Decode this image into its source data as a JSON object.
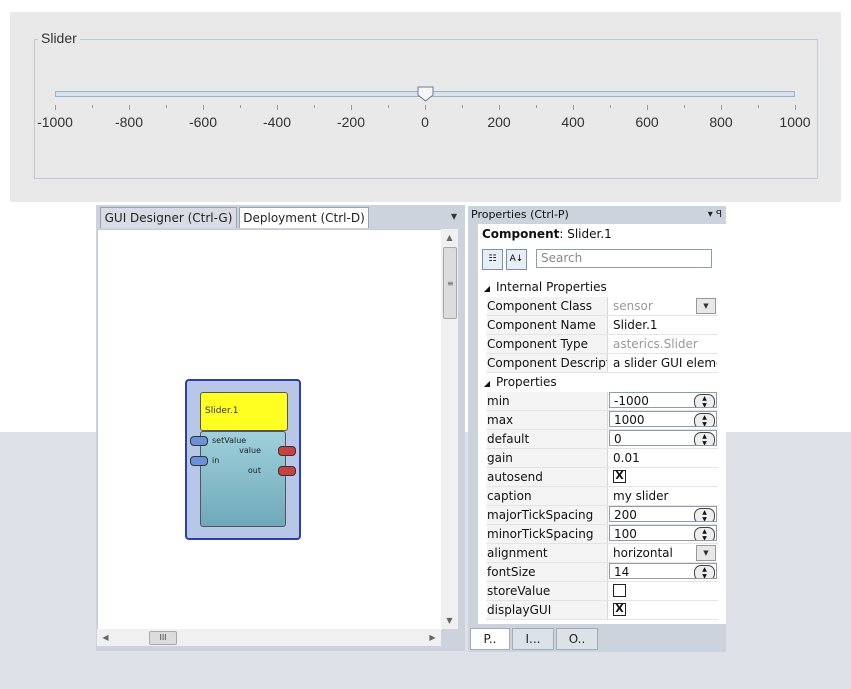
{
  "slider_preview": {
    "caption": "Slider",
    "min": -1000,
    "max": 1000,
    "value": 0,
    "tick_labels": [
      "-1000",
      "-800",
      "-600",
      "-400",
      "-200",
      "0",
      "200",
      "400",
      "600",
      "800",
      "1000"
    ]
  },
  "designer": {
    "tabs": [
      {
        "label": "GUI Designer (Ctrl-G)"
      },
      {
        "label": "Deployment (Ctrl-D)"
      }
    ],
    "menu_glyph": "▾",
    "component": {
      "title": "Slider.1",
      "input_ports": [
        "setValue",
        "in"
      ],
      "output_ports": [
        "value",
        "out"
      ]
    },
    "hscroll_grip": "III"
  },
  "properties": {
    "title": "Properties (Ctrl-P)",
    "pin_glyph": "▾ ꟼ",
    "component_label": "Component",
    "component_name": ": Slider.1",
    "search_placeholder": "Search",
    "categories": {
      "internal": "Internal Properties",
      "properties": "Properties"
    },
    "internal_rows": [
      {
        "name": "Component Class",
        "value": "sensor"
      },
      {
        "name": "Component Name",
        "value": "Slider.1"
      },
      {
        "name": "Component Type",
        "value": "asterics.Slider"
      },
      {
        "name": "Component Descriptic",
        "value": "a slider GUI elemen"
      }
    ],
    "property_rows": [
      {
        "name": "min",
        "value": "-1000"
      },
      {
        "name": "max",
        "value": "1000"
      },
      {
        "name": "default",
        "value": "0"
      },
      {
        "name": "gain",
        "value": "0.01"
      },
      {
        "name": "autosend",
        "value": "X"
      },
      {
        "name": "caption",
        "value": "my slider"
      },
      {
        "name": "majorTickSpacing",
        "value": "200"
      },
      {
        "name": "minorTickSpacing",
        "value": "100"
      },
      {
        "name": "alignment",
        "value": "horizontal"
      },
      {
        "name": "fontSize",
        "value": "14"
      },
      {
        "name": "storeValue",
        "value": ""
      },
      {
        "name": "displayGUI",
        "value": "X"
      }
    ],
    "bottom_tabs": [
      "P..",
      "I...",
      "O.."
    ]
  }
}
